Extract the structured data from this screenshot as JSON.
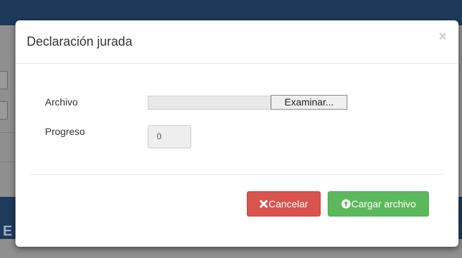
{
  "modal": {
    "title": "Declaración jurada",
    "close_glyph": "×"
  },
  "form": {
    "file_label": "Archivo",
    "browse_label": "Examinar...",
    "progress_label": "Progreso",
    "progress_value": "0"
  },
  "buttons": {
    "cancel_label": "Cancelar",
    "cancel_icon": "times-icon",
    "upload_label": "Cargar archivo",
    "upload_icon": "circle-arrow-up-icon"
  },
  "background": {
    "band_letter": "E"
  },
  "colors": {
    "cancel": "#d9534f",
    "upload": "#5cb85c",
    "header_band": "#1d3a5a"
  }
}
